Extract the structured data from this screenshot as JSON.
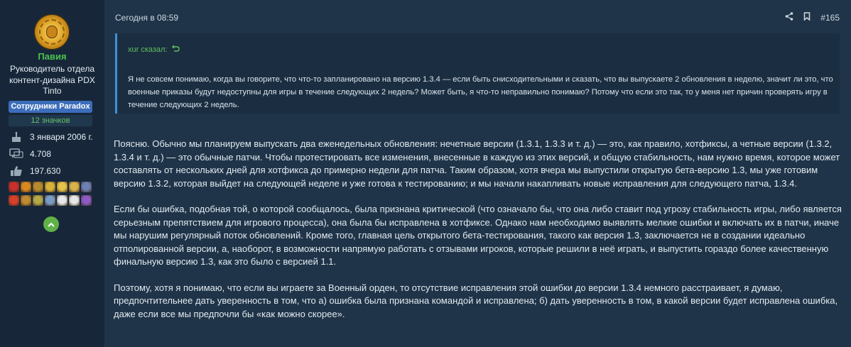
{
  "user": {
    "name": "Павия",
    "title": "Руководитель отдела контент-дизайна PDX Tinto",
    "staff_badge": "Сотрудники Paradox",
    "badges": "12 значков",
    "joined": "3 января 2006 г.",
    "messages": "4.708",
    "reactions": "197.630"
  },
  "post": {
    "time": "Сегодня в 08:59",
    "number": "#165",
    "quote": {
      "author": "xur сказал:",
      "text": "Я не совсем понимаю, когда вы говорите, что что-то запланировано на версию 1.3.4 — если быть снисходительными и сказать, что вы выпускаете 2 обновления в неделю, значит ли это, что военные приказы будут недоступны для игры в течение следующих 2 недель? Может быть, я что-то неправильно понимаю? Потому что если это так, то у меня нет причин проверять игру в течение следующих 2 недель."
    },
    "paragraphs": [
      "Поясню. Обычно мы планируем выпускать два еженедельных обновления: нечетные версии (1.3.1, 1.3.3 и т. д.) — это, как правило, хотфиксы, а четные версии (1.3.2, 1.3.4 и т. д.) — это обычные патчи. Чтобы протестировать все изменения, внесенные в каждую из этих версий, и общую стабильность, нам нужно время, которое может составлять от нескольких дней для хотфикса до примерно недели для патча. Таким образом, хотя вчера мы выпустили открытую бета-версию 1.3, мы уже готовим версию 1.3.2, которая выйдет на следующей неделе и уже готова к тестированию; и мы начали накапливать новые исправления для следующего патча, 1.3.4.",
      "Если бы ошибка, подобная той, о которой сообщалось, была признана критической (что означало бы, что она либо ставит под угрозу стабильность игры, либо является серьезным препятствием для игрового процесса), она была бы исправлена в хотфиксе. Однако нам необходимо выявлять мелкие ошибки и включать их в патчи, иначе мы нарушим регулярный поток обновлений. Кроме того, главная цель открытого бета-тестирования, такого как версия 1.3, заключается не в создании идеально отполированной версии, а, наоборот, в возможности напрямую работать с отзывами игроков, которые решили в неё играть, и выпустить гораздо более качественную финальную версию 1.3, как это было с версией 1.1.",
      "Поэтому, хотя я понимаю, что если вы играете за Военный орден, то отсутствие исправления этой ошибки до версии 1.3.4 немного расстраивает, я думаю, предпочтительнее дать уверенность в том, что а) ошибка была признана командой и исправлена; б) дать уверенность в том, в какой версии будет исправлена ошибка, даже если все мы предпочли бы «как можно скорее»."
    ]
  },
  "colors": {
    "accent_green": "#4cc24c",
    "staff_blue": "#3c6dbb",
    "quote_bar": "#3f8fd6"
  },
  "medals": [
    {
      "name": "medal-shield-icon",
      "color": "#c9302c"
    },
    {
      "name": "medal-horns-icon",
      "color": "#d98a1f"
    },
    {
      "name": "medal-wreath-icon",
      "color": "#b88a2e"
    },
    {
      "name": "medal-sun-icon",
      "color": "#d9b23a"
    },
    {
      "name": "medal-crown-icon",
      "color": "#e6c34a"
    },
    {
      "name": "medal-crown2-icon",
      "color": "#d8b24c"
    },
    {
      "name": "medal-mountain-icon",
      "color": "#6d7fb3"
    },
    {
      "name": "medal-fire-icon",
      "color": "#d6402a"
    },
    {
      "name": "medal-gear-icon",
      "color": "#c08a32"
    },
    {
      "name": "medal-ring-icon",
      "color": "#b3a84a"
    },
    {
      "name": "medal-castle-icon",
      "color": "#7a9cc4"
    },
    {
      "name": "medal-yinyang-icon",
      "color": "#e8e8e8"
    },
    {
      "name": "medal-swirl-icon",
      "color": "#e6e6e6"
    },
    {
      "name": "medal-purple-icon",
      "color": "#8e5bc4"
    }
  ]
}
